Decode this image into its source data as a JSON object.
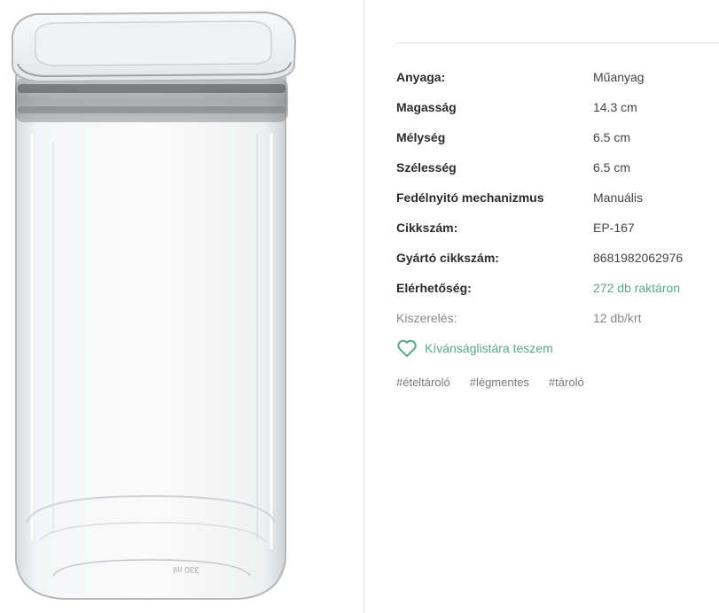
{
  "product_image": {
    "alt_icon": "glass-storage-jar-image",
    "embossed_text": "330 ml"
  },
  "specs": [
    {
      "label": "Anyaga:",
      "value": "Műanyag",
      "style": "normal"
    },
    {
      "label": "Magasság",
      "value": "14.3 cm",
      "style": "normal"
    },
    {
      "label": "Mélység",
      "value": "6.5 cm",
      "style": "normal"
    },
    {
      "label": "Szélesség",
      "value": "6.5 cm",
      "style": "normal"
    },
    {
      "label": "Fedélnyitó mechanizmus",
      "value": "Manuális",
      "style": "normal"
    },
    {
      "label": "Cikkszám:",
      "value": "EP-167",
      "style": "normal"
    },
    {
      "label": "Gyártó cikkszám:",
      "value": "8681982062976",
      "style": "normal"
    },
    {
      "label": "Elérhetőség:",
      "value": "272 db raktáron",
      "style": "stock"
    },
    {
      "label": "Kiszerelés:",
      "value": "12 db/krt",
      "style": "muted"
    }
  ],
  "wishlist": {
    "icon": "heart-outline-icon",
    "label": "Kívánságlistára teszem",
    "color": "#5aa885"
  },
  "tags": [
    "#ételtároló",
    "#légmentes",
    "#tároló"
  ],
  "colors": {
    "accent": "#5aa885",
    "label_text": "#2b2b2b",
    "value_text": "#444444",
    "muted_text": "#888888"
  }
}
